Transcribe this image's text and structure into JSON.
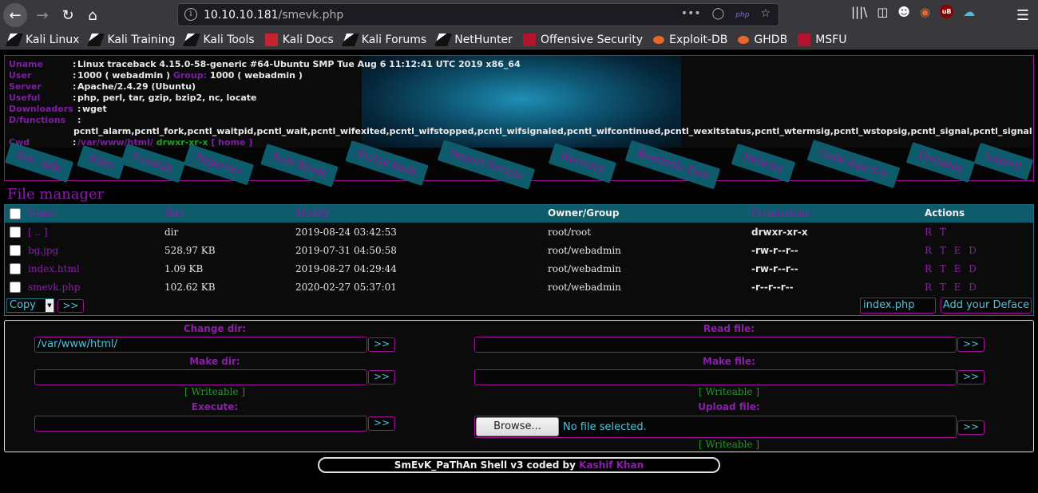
{
  "browser": {
    "url_host": "10.10.10.181",
    "url_path": "/smevk.php",
    "url_badge": "php",
    "bookmarks": [
      "Kali Linux",
      "Kali Training",
      "Kali Tools",
      "Kali Docs",
      "Kali Forums",
      "NetHunter",
      "Offensive Security",
      "Exploit-DB",
      "GHDB",
      "MSFU"
    ],
    "addon_badge": "uB"
  },
  "sysinfo": {
    "uname_label": "Uname",
    "uname": "Linux traceback 4.15.0-58-generic #64-Ubuntu SMP Tue Aug 6 11:12:41 UTC 2019 x86_64",
    "user_label": "User",
    "user_val": "1000 ( webadmin )",
    "group_label": "Group:",
    "group_val": "1000 ( webadmin )",
    "server_label": "Server",
    "server": "Apache/2.4.29 (Ubuntu)",
    "useful_label": "Useful",
    "useful": "php, perl, tar, gzip, bzip2, nc, locate",
    "downloaders_label": "Downloaders",
    "downloaders": "wget",
    "dfunctions_label": "D/functions",
    "dfunctions": "pcntl_alarm,pcntl_fork,pcntl_waitpid,pcntl_wait,pcntl_wifexited,pcntl_wifstopped,pcntl_wifsignaled,pcntl_wifcontinued,pcntl_wexitstatus,pcntl_wtermsig,pcntl_wstopsig,pcntl_signal,pcntl_signal",
    "cwd_label": "Cwd",
    "cwd": "/var/www/html/",
    "cwd_perm": "drwxr-xr-x",
    "cwd_home": "[ home ]",
    "colon": ":"
  },
  "menu": [
    "Sec. Info",
    "Files",
    "Console",
    "Bypasser",
    "Safe Mode",
    "String tools",
    "Import Scripts",
    "Network",
    "Readable Dirs",
    "Defacer",
    "Code Injector",
    "Domains",
    "Logout"
  ],
  "file_manager": {
    "title": "File manager",
    "columns": [
      "Name",
      "Size",
      "Modify",
      "Owner/Group",
      "Permissions",
      "Actions"
    ],
    "rows": [
      {
        "name": "[ .. ]",
        "size": "dir",
        "modify": "2019-08-24 03:42:53",
        "owner": "root/root",
        "perm": "drwxr-xr-x",
        "actions": "R T"
      },
      {
        "name": "bg.jpg",
        "size": "528.97 KB",
        "modify": "2019-07-31 04:50:58",
        "owner": "root/webadmin",
        "perm": "-rw-r--r--",
        "actions": "R T E D"
      },
      {
        "name": "index.html",
        "size": "1.09 KB",
        "modify": "2019-08-27 04:29:44",
        "owner": "root/webadmin",
        "perm": "-rw-r--r--",
        "actions": "R T E D"
      },
      {
        "name": "smevk.php",
        "size": "102.62 KB",
        "modify": "2020-02-27 05:37:01",
        "owner": "root/webadmin",
        "perm": "-r--r--r--",
        "actions": "R T E D"
      }
    ],
    "action_select": "Copy",
    "go_label": ">>",
    "deface_file": "index.php",
    "deface_button": "Add your Deface"
  },
  "tools": {
    "change_dir_label": "Change dir:",
    "change_dir_value": "/var/www/html/",
    "read_file_label": "Read file:",
    "make_dir_label": "Make dir:",
    "make_file_label": "Make file:",
    "writeable": "[ Writeable ]",
    "execute_label": "Execute:",
    "upload_label": "Upload file:",
    "browse_label": "Browse...",
    "browse_status": "No file selected.",
    "go": ">>"
  },
  "footer": {
    "text": "SmEvK_PaThAn Shell v3 coded by",
    "author": "Kashif Khan"
  }
}
